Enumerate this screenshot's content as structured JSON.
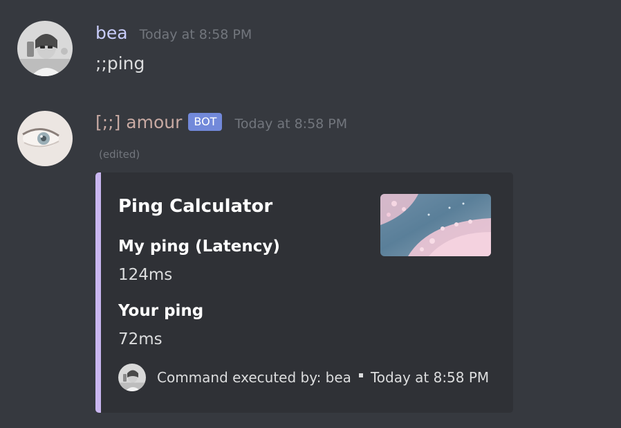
{
  "messages": [
    {
      "author": "bea",
      "author_color": "#c9cdfb",
      "timestamp": "Today at 8:58 PM",
      "content": ";;ping"
    },
    {
      "author": "[;;] amour",
      "author_color": "#c8aaa3",
      "bot_tag": "BOT",
      "timestamp": "Today at 8:58 PM",
      "edited": "(edited)",
      "embed": {
        "accent_color": "#c9b6f0",
        "title": "Ping Calculator",
        "thumbnail": "cherry-blossom-image",
        "fields": [
          {
            "name": "My ping (Latency)",
            "value": "124ms"
          },
          {
            "name": "Your ping",
            "value": "72ms"
          }
        ],
        "footer": {
          "text": "Command executed by: bea",
          "timestamp": "Today at 8:58 PM"
        }
      }
    }
  ]
}
